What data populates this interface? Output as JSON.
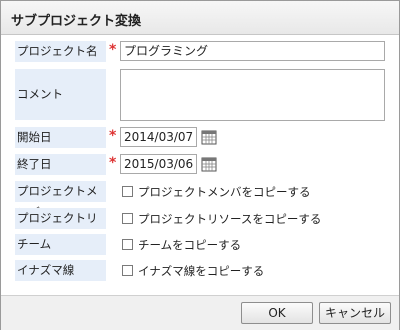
{
  "dialog": {
    "title": "サブプロジェクト変換"
  },
  "fields": {
    "project_name": {
      "label": "プロジェクト名",
      "value": "プログラミング",
      "required_mark": "*"
    },
    "comment": {
      "label": "コメント",
      "value": ""
    },
    "start_date": {
      "label": "開始日",
      "value": "2014/03/07",
      "required_mark": "*"
    },
    "end_date": {
      "label": "終了日",
      "value": "2015/03/06",
      "required_mark": "*"
    }
  },
  "options": {
    "members": {
      "label": "プロジェクトメンバ",
      "checkbox_label": "プロジェクトメンバをコピーする",
      "checked": false
    },
    "resources": {
      "label": "プロジェクトリソース",
      "checkbox_label": "プロジェクトリソースをコピーする",
      "checked": false
    },
    "team": {
      "label": "チーム",
      "checkbox_label": "チームをコピーする",
      "checked": false
    },
    "lightning": {
      "label": "イナズマ線",
      "checkbox_label": "イナズマ線をコピーする",
      "checked": false
    }
  },
  "buttons": {
    "ok": "OK",
    "cancel": "キャンセル"
  },
  "icons": {
    "calendar": "calendar-icon",
    "required": "required-asterisk"
  },
  "colors": {
    "label_bg": "#e6eef9",
    "required": "#dd3333"
  }
}
